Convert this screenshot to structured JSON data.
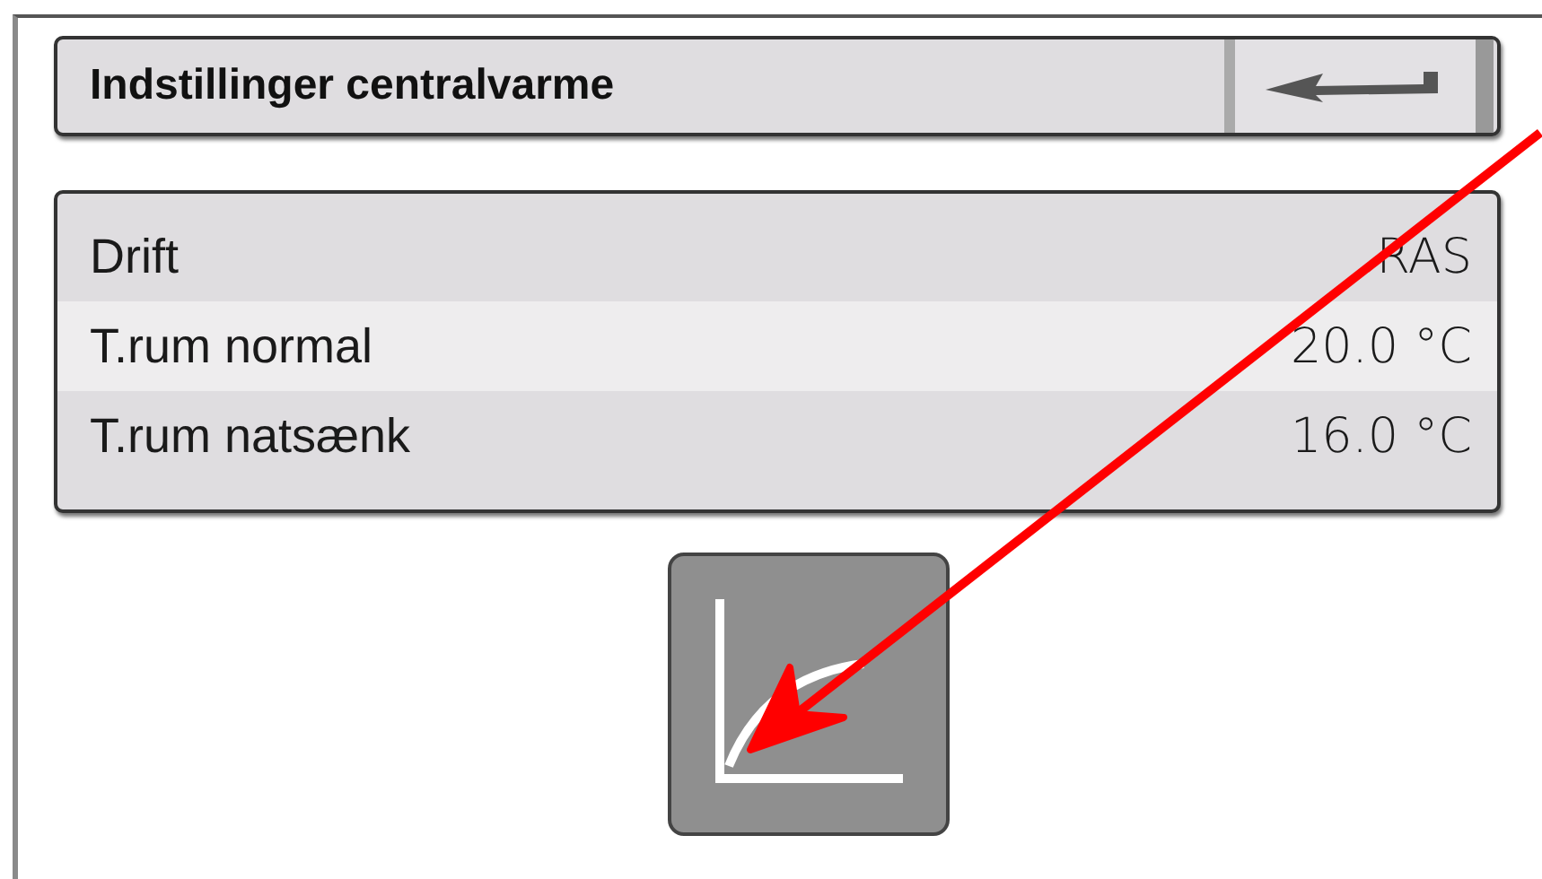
{
  "header": {
    "title": "Indstillinger centralvarme"
  },
  "settings": [
    {
      "label": "Drift",
      "value": "RAS",
      "selected": false
    },
    {
      "label": "T.rum normal",
      "value": "20.0 °C",
      "selected": true
    },
    {
      "label": "T.rum natsænk",
      "value": "16.0 °C",
      "selected": false
    }
  ]
}
